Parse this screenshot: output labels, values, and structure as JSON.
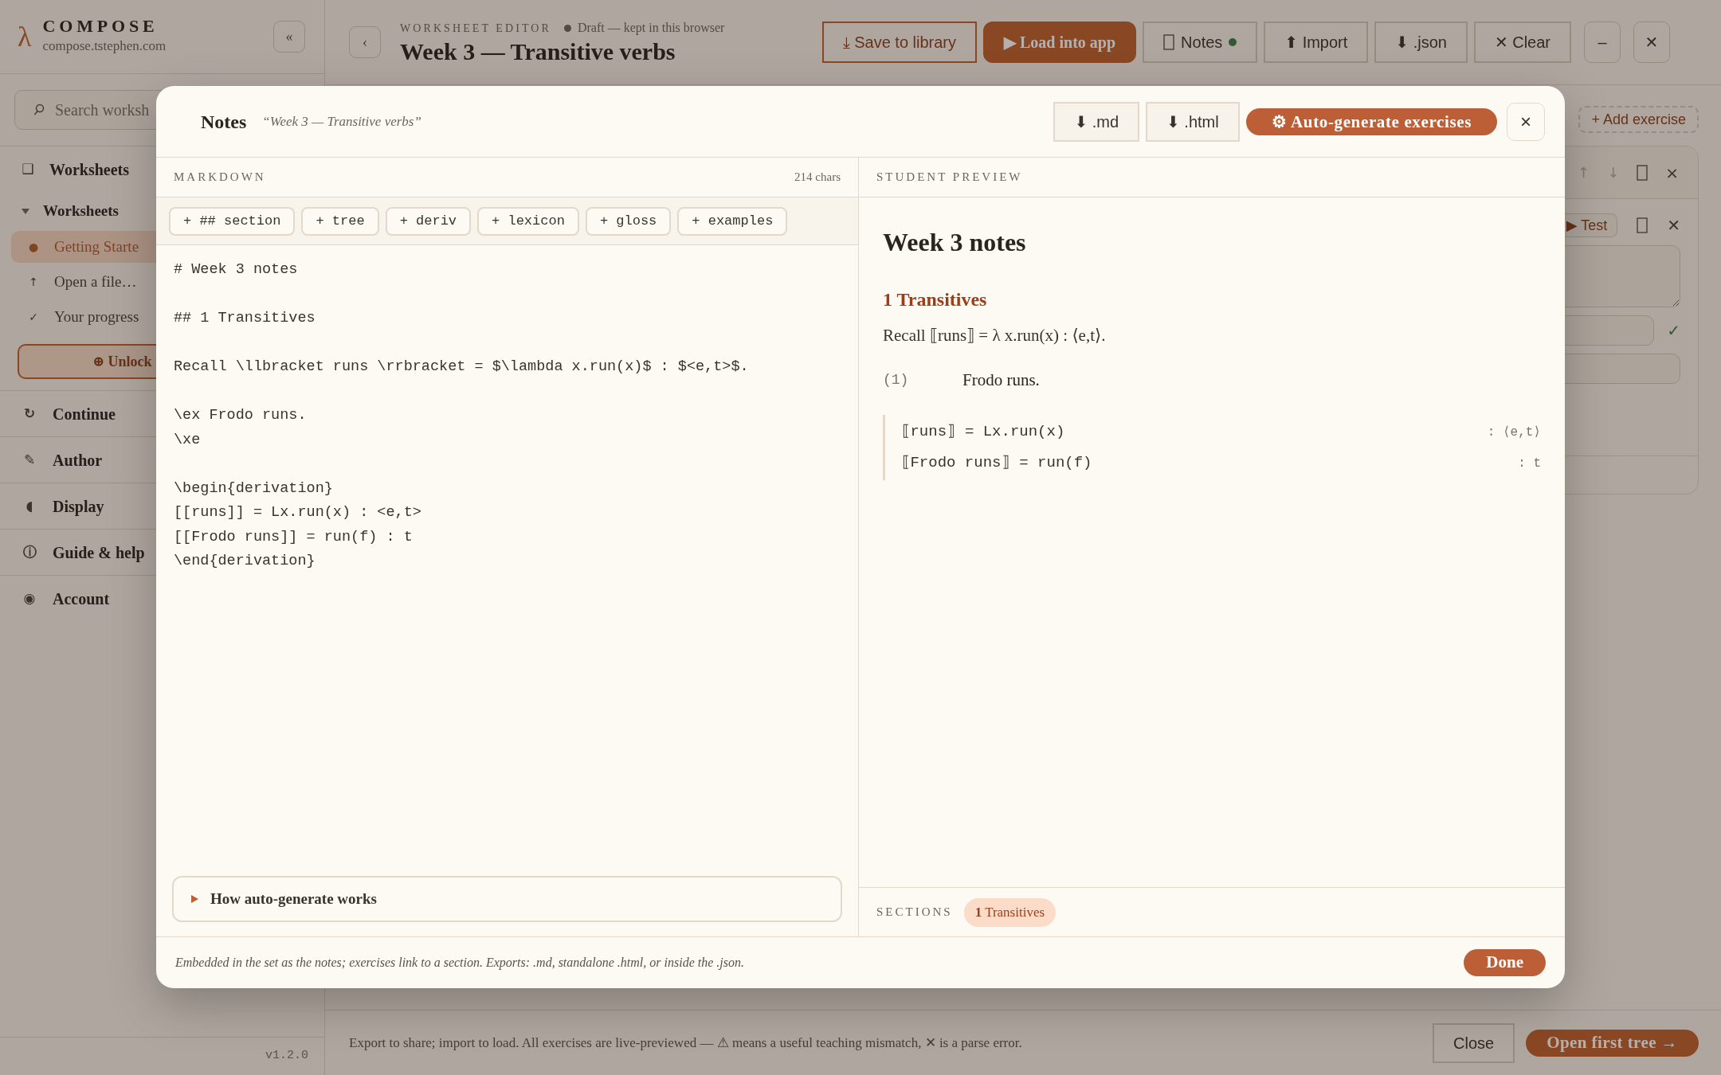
{
  "sidebar": {
    "logo": "λ",
    "brand": "COMPOSE",
    "domain": "compose.tstephen.com",
    "collapse": "«",
    "search": {
      "placeholder": "Search worksh"
    },
    "primary": {
      "icon": "❑",
      "label": "Worksheets"
    },
    "group": {
      "label": "Worksheets",
      "expanded": true,
      "items": [
        {
          "icon": "●",
          "label": "Getting Starte",
          "selected": true
        },
        {
          "icon": "↑",
          "label": "Open a file…",
          "selected": false
        },
        {
          "icon": "✓",
          "label": "Your progress",
          "selected": false
        }
      ]
    },
    "unlock": "⊕ Unlock",
    "sections": [
      {
        "icon": "↻",
        "label": "Continue"
      },
      {
        "icon": "✎",
        "label": "Author"
      },
      {
        "icon": "◖",
        "label": "Display"
      },
      {
        "icon": "ⓘ",
        "label": "Guide & help"
      },
      {
        "icon": "◉",
        "label": "Account"
      }
    ],
    "version": "v1.2.0"
  },
  "header": {
    "back": "‹",
    "eyebrow": "WORKSHEET EDITOR",
    "status": "Draft — kept in this browser",
    "title": "Week 3 — Transitive verbs",
    "buttons": [
      {
        "label": "⤓ Save to library",
        "kind": "outline"
      },
      {
        "label": "▶ Load into app",
        "kind": "primary"
      },
      {
        "label": "Notes",
        "kind": "notes",
        "indicator": true
      },
      {
        "label": "⬆ Import",
        "kind": "plain"
      },
      {
        "label": "⬇ .json",
        "kind": "plain"
      },
      {
        "label": "✕ Clear",
        "kind": "plain"
      },
      {
        "label": "–",
        "kind": "square"
      },
      {
        "label": "✕",
        "kind": "square"
      }
    ]
  },
  "editor": {
    "add_button": "+ Add exercise",
    "card_arrows": [
      "↑",
      "↓"
    ],
    "card_close": "×",
    "test_button": "▶ Test",
    "row_close": "✕",
    "check": "✓"
  },
  "footer": {
    "hint": "Export to share; import to load. All exercises are live-previewed — ⚠ means a useful teaching mismatch, ✕ is a parse error.",
    "close": "Close",
    "primary": "Open first tree →"
  },
  "modal": {
    "title": "Notes",
    "subtitle": "“Week 3 — Transitive verbs”",
    "actions": [
      {
        "label": "⬇ .md",
        "kind": "plain"
      },
      {
        "label": "⬇ .html",
        "kind": "plain"
      },
      {
        "label": "⚙ Auto-generate exercises",
        "kind": "primary"
      }
    ],
    "close": "×",
    "markdown": {
      "heading": "MARKDOWN",
      "count": "214 chars",
      "snippets": [
        "+ ## section",
        "+ tree",
        "+ deriv",
        "+ lexicon",
        "+ gloss",
        "+ examples"
      ],
      "content": "# Week 3 notes\n\n## 1 Transitives\n\nRecall \\llbracket runs \\rrbracket = $\\lambda x.run(x)$ : $<e,t>$.\n\n\\ex Frodo runs.\n\\xe\n\n\\begin{derivation}\n[[runs]] = Lx.run(x) : <e,t>\n[[Frodo runs]] = run(f) : t\n\\end{derivation}",
      "help": {
        "label": "How auto-generate works",
        "expanded": false
      }
    },
    "preview": {
      "heading": "STUDENT PREVIEW",
      "title": "Week 3 notes",
      "section": {
        "heading": "1 Transitives",
        "recall": "Recall ⟦runs⟧ = λ x.run(x) : ⟨e,t⟩.",
        "example": {
          "number": "(1)",
          "text": "Frodo runs."
        },
        "derivation": [
          {
            "formula": "⟦runs⟧ = Lx.run(x)",
            "type": ": ⟨e,t⟩"
          },
          {
            "formula": "⟦Frodo runs⟧ = run(f)",
            "type": ": t"
          }
        ]
      },
      "toc_label": "SECTIONS",
      "toc": [
        {
          "label": "**1** Transitives",
          "selected": false
        }
      ]
    },
    "note": "Embedded in the set as the notes; exercises link to a section. Exports: .md, standalone .html, or inside the .json.",
    "done": "Done"
  }
}
